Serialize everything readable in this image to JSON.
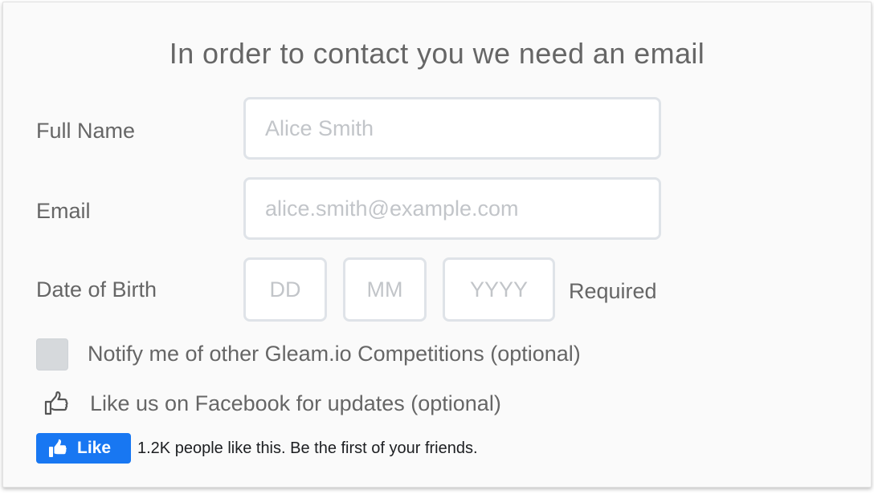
{
  "form": {
    "title": "In order to contact you we need an email",
    "full_name": {
      "label": "Full Name",
      "placeholder": "Alice Smith",
      "value": ""
    },
    "email": {
      "label": "Email",
      "placeholder": "alice.smith@example.com",
      "value": ""
    },
    "dob": {
      "label": "Date of Birth",
      "day_placeholder": "DD",
      "month_placeholder": "MM",
      "year_placeholder": "YYYY",
      "required_text": "Required"
    },
    "notify": {
      "label": "Notify me of other Gleam.io Competitions (optional)",
      "checked": false
    },
    "facebook": {
      "label": "Like us on Facebook for updates (optional)",
      "icon": "thumbs-up-icon",
      "like_button_label": "Like",
      "like_count_text": "1.2K people like this. Be the first of your friends."
    }
  },
  "colors": {
    "facebook_blue": "#1877f2",
    "input_border": "#dfe3e8",
    "text": "#666666"
  }
}
